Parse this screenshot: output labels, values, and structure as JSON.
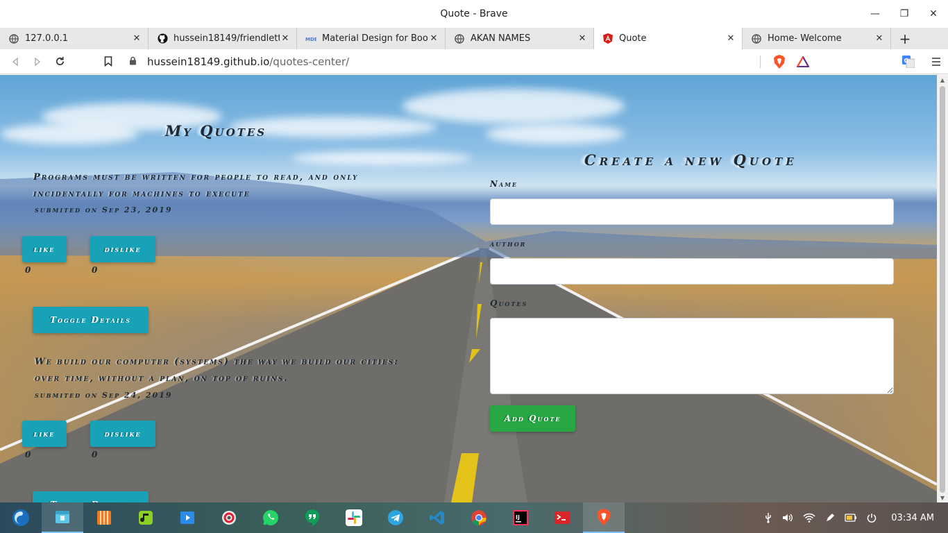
{
  "window": {
    "title": "Quote - Brave"
  },
  "tabs": [
    {
      "label": "127.0.0.1",
      "icon": "globe-icon"
    },
    {
      "label": "hussein18149/friendletter-",
      "icon": "github-icon"
    },
    {
      "label": "Material Design for Bootst",
      "icon": "mdb-icon"
    },
    {
      "label": "AKAN NAMES",
      "icon": "globe-icon"
    },
    {
      "label": "Quote",
      "icon": "angular-icon",
      "active": true
    },
    {
      "label": "Home- Welcome",
      "icon": "globe-icon"
    }
  ],
  "address": {
    "host": "hussein18149.github.io",
    "path": "/quotes-center/"
  },
  "left": {
    "heading": "My Quotes",
    "quotes": [
      {
        "line1": "Programs must be written for people to read, and only",
        "line2": "incidentally for machines to execute",
        "submitted": "submited on Sep 23, 2019",
        "like_label": "like",
        "dislike_label": "dislike",
        "likes": "0",
        "dislikes": "0",
        "toggle_label": "Toggle Details"
      },
      {
        "line1": "We build our computer (systems) the way we build our cities:",
        "line2": "over time, without a plan, on top of ruins.",
        "submitted": "submited on Sep 24, 2019",
        "like_label": "like",
        "dislike_label": "dislike",
        "likes": "0",
        "dislikes": "0",
        "toggle_label": "Toggle Details"
      }
    ]
  },
  "form": {
    "heading": "Create a new Quote",
    "name_label": "Name",
    "author_label": "author",
    "quotes_label": "Quotes",
    "name_value": "",
    "author_value": "",
    "quotes_value": "",
    "submit_label": "Add Quote"
  },
  "taskbar": {
    "clock": "03:34 AM",
    "apps": [
      "launcher-icon",
      "files-icon",
      "archive-icon",
      "music-icon",
      "video-icon",
      "settings-icon",
      "whatsapp-icon",
      "hangouts-icon",
      "slack-icon",
      "telegram-icon",
      "vscode-icon",
      "chrome-icon",
      "intellij-icon",
      "terminal-icon",
      "brave-icon"
    ]
  },
  "colors": {
    "info_button": "#17a2b8",
    "success_button": "#28a745",
    "heading_text": "#1e2a33"
  }
}
